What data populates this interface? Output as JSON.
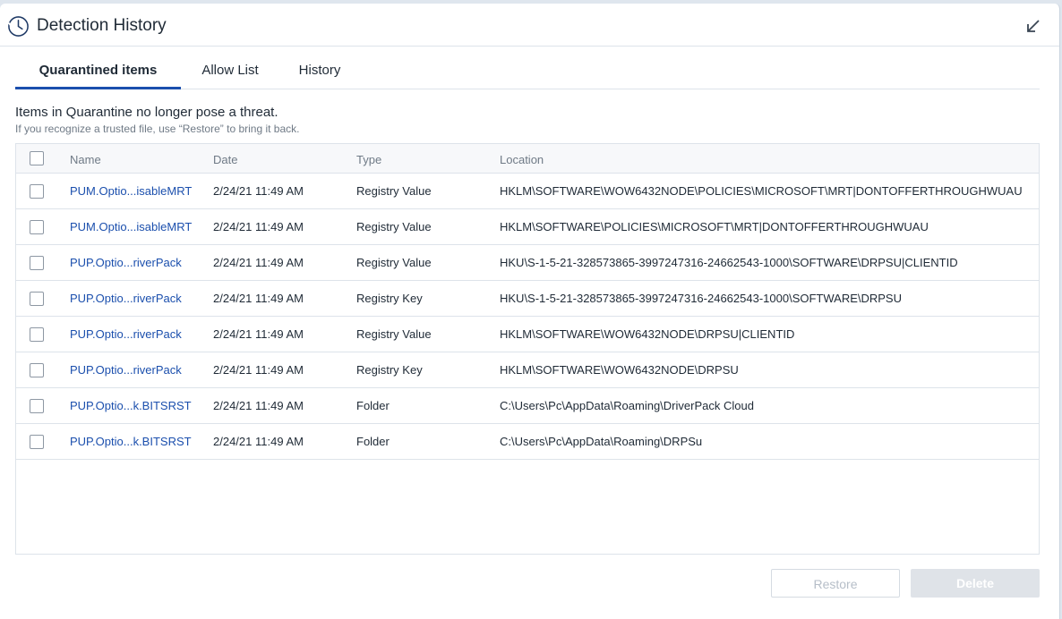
{
  "window": {
    "title": "Detection History",
    "title_icon": "clock-icon",
    "collapse_icon": "collapse-arrow-icon"
  },
  "tabs": [
    {
      "label": "Quarantined items",
      "active": true
    },
    {
      "label": "Allow List",
      "active": false
    },
    {
      "label": "History",
      "active": false
    }
  ],
  "info": {
    "main": "Items in Quarantine no longer pose a threat.",
    "sub": "If you recognize a trusted file, use “Restore” to bring it back."
  },
  "table": {
    "headers": {
      "name": "Name",
      "date": "Date",
      "type": "Type",
      "location": "Location"
    },
    "rows": [
      {
        "name": "PUM.Optio...isableMRT",
        "date": "2/24/21 11:49 AM",
        "type": "Registry Value",
        "location": "HKLM\\SOFTWARE\\WOW6432NODE\\POLICIES\\MICROSOFT\\MRT|DONTOFFERTHROUGHWUAU"
      },
      {
        "name": "PUM.Optio...isableMRT",
        "date": "2/24/21 11:49 AM",
        "type": "Registry Value",
        "location": "HKLM\\SOFTWARE\\POLICIES\\MICROSOFT\\MRT|DONTOFFERTHROUGHWUAU"
      },
      {
        "name": "PUP.Optio...riverPack",
        "date": "2/24/21 11:49 AM",
        "type": "Registry Value",
        "location": "HKU\\S-1-5-21-328573865-3997247316-24662543-1000\\SOFTWARE\\DRPSU|CLIENTID"
      },
      {
        "name": "PUP.Optio...riverPack",
        "date": "2/24/21 11:49 AM",
        "type": "Registry Key",
        "location": "HKU\\S-1-5-21-328573865-3997247316-24662543-1000\\SOFTWARE\\DRPSU"
      },
      {
        "name": "PUP.Optio...riverPack",
        "date": "2/24/21 11:49 AM",
        "type": "Registry Value",
        "location": "HKLM\\SOFTWARE\\WOW6432NODE\\DRPSU|CLIENTID"
      },
      {
        "name": "PUP.Optio...riverPack",
        "date": "2/24/21 11:49 AM",
        "type": "Registry Key",
        "location": "HKLM\\SOFTWARE\\WOW6432NODE\\DRPSU"
      },
      {
        "name": "PUP.Optio...k.BITSRST",
        "date": "2/24/21 11:49 AM",
        "type": "Folder",
        "location": "C:\\Users\\Pc\\AppData\\Roaming\\DriverPack Cloud"
      },
      {
        "name": "PUP.Optio...k.BITSRST",
        "date": "2/24/21 11:49 AM",
        "type": "Folder",
        "location": "C:\\Users\\Pc\\AppData\\Roaming\\DRPSu"
      }
    ]
  },
  "buttons": {
    "restore": "Restore",
    "delete": "Delete"
  },
  "colors": {
    "accent": "#1b4fad",
    "link": "#1b4fad",
    "border": "#dde3ea"
  }
}
